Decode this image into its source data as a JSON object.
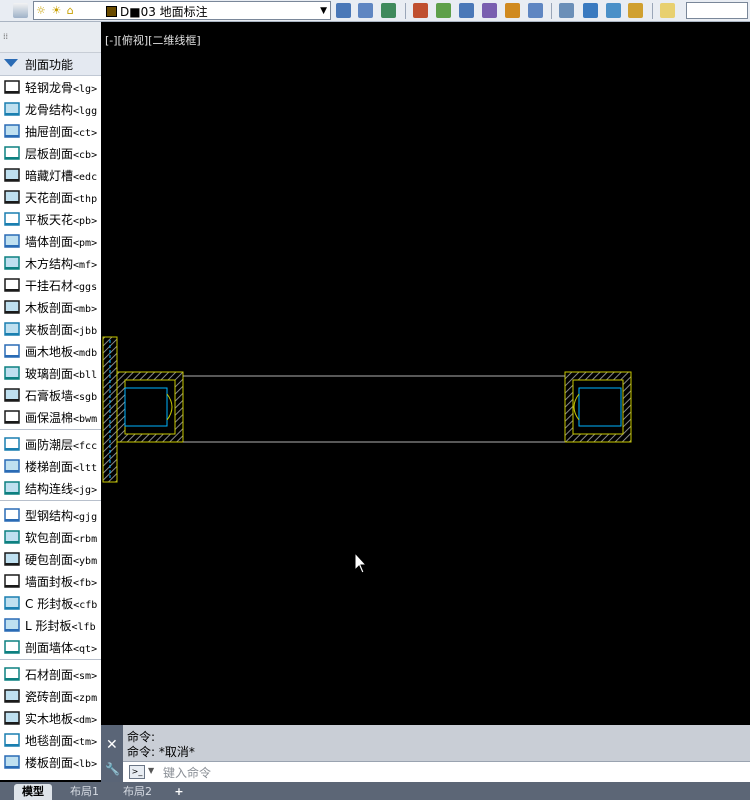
{
  "toolbar": {
    "layer_selector": {
      "value": "D■03 地面标注",
      "state_icons": [
        "lightbulb-icon",
        "sun-icon",
        "unlock-icon"
      ],
      "swatch_color": "#6a4b00"
    },
    "tool_icons": [
      "layer-states-icon",
      "match-layer-icon",
      "previous-layer-icon",
      "isolate-layer-icon",
      "unisolate-layer-icon",
      "freeze-layer-icon",
      "off-layer-icon",
      "lock-layer-icon",
      "walk-layer-icon",
      "layer-tools-icon",
      "merge-layer-icon",
      "note-icon"
    ]
  },
  "panel": {
    "header": "剖面功能",
    "groups": [
      [
        {
          "label": "轻钢龙骨",
          "cmd": "<lg>",
          "icon": "light-steel-keel-icon"
        },
        {
          "label": "龙骨结构",
          "cmd": "<lgg",
          "icon": "keel-structure-icon"
        },
        {
          "label": "抽屉剖面",
          "cmd": "<ct>",
          "icon": "drawer-section-icon"
        },
        {
          "label": "层板剖面",
          "cmd": "<cb>",
          "icon": "shelf-section-icon"
        },
        {
          "label": "暗藏灯槽",
          "cmd": "<edc",
          "icon": "hidden-light-slot-icon"
        },
        {
          "label": "天花剖面",
          "cmd": "<thp",
          "icon": "ceiling-section-icon"
        },
        {
          "label": "平板天花",
          "cmd": "<pb>",
          "icon": "flat-ceiling-icon"
        },
        {
          "label": "墙体剖面",
          "cmd": "<pm>",
          "icon": "wall-section-icon"
        },
        {
          "label": "木方结构",
          "cmd": "<mf>",
          "icon": "timber-structure-icon"
        },
        {
          "label": "干挂石材",
          "cmd": "<ggs",
          "icon": "dry-hang-stone-icon"
        },
        {
          "label": "木板剖面",
          "cmd": "<mb>",
          "icon": "wood-board-section-icon"
        },
        {
          "label": "夹板剖面",
          "cmd": "<jbb",
          "icon": "plywood-section-icon"
        },
        {
          "label": "画木地板",
          "cmd": "<mdb",
          "icon": "wood-floor-icon"
        },
        {
          "label": "玻璃剖面",
          "cmd": "<bll",
          "icon": "glass-section-icon"
        },
        {
          "label": "石膏板墙",
          "cmd": "<sgb",
          "icon": "gypsum-wall-icon"
        },
        {
          "label": "画保温棉",
          "cmd": "<bwm",
          "icon": "insulation-icon"
        }
      ],
      [
        {
          "label": "画防潮层",
          "cmd": "<fcc",
          "icon": "moisture-barrier-icon"
        },
        {
          "label": "楼梯剖面",
          "cmd": "<ltt",
          "icon": "stair-section-icon"
        },
        {
          "label": "结构连线",
          "cmd": "<jg>",
          "icon": "structure-line-icon"
        }
      ],
      [
        {
          "label": "型钢结构",
          "cmd": "<gjg",
          "icon": "steel-section-icon"
        },
        {
          "label": "软包剖面",
          "cmd": "<rbm",
          "icon": "soft-pack-section-icon"
        },
        {
          "label": "硬包剖面",
          "cmd": "<ybm",
          "icon": "hard-pack-section-icon"
        },
        {
          "label": "墙面封板",
          "cmd": "<fb>",
          "icon": "wall-cover-icon"
        },
        {
          "label": "C 形封板",
          "cmd": "<cfb",
          "icon": "c-cover-icon"
        },
        {
          "label": "L 形封板",
          "cmd": "<lfb",
          "icon": "l-cover-icon"
        },
        {
          "label": "剖面墙体",
          "cmd": "<qt>",
          "icon": "section-wall-icon"
        }
      ],
      [
        {
          "label": "石材剖面",
          "cmd": "<sm>",
          "icon": "stone-section-icon"
        },
        {
          "label": "瓷砖剖面",
          "cmd": "<zpm",
          "icon": "tile-section-icon"
        },
        {
          "label": "实木地板",
          "cmd": "<dm>",
          "icon": "solid-wood-floor-icon"
        },
        {
          "label": "地毯剖面",
          "cmd": "<tm>",
          "icon": "carpet-section-icon"
        },
        {
          "label": "楼板剖面",
          "cmd": "<lb>",
          "icon": "floor-slab-section-icon"
        }
      ]
    ]
  },
  "viewport": {
    "label": "[-][俯视][二维线框]",
    "background": "#000000"
  },
  "command": {
    "history": [
      "命令:",
      "命令: *取消*"
    ],
    "placeholder": "键入命令"
  },
  "tabs": [
    {
      "label": "模型",
      "active": true
    },
    {
      "label": "布局1",
      "active": false
    },
    {
      "label": "布局2",
      "active": false
    }
  ],
  "colors": {
    "section_outline": "#c8c800",
    "hatch": "#8a8a8a",
    "insulation": "#00b4ff",
    "line": "#b0b0b0"
  }
}
